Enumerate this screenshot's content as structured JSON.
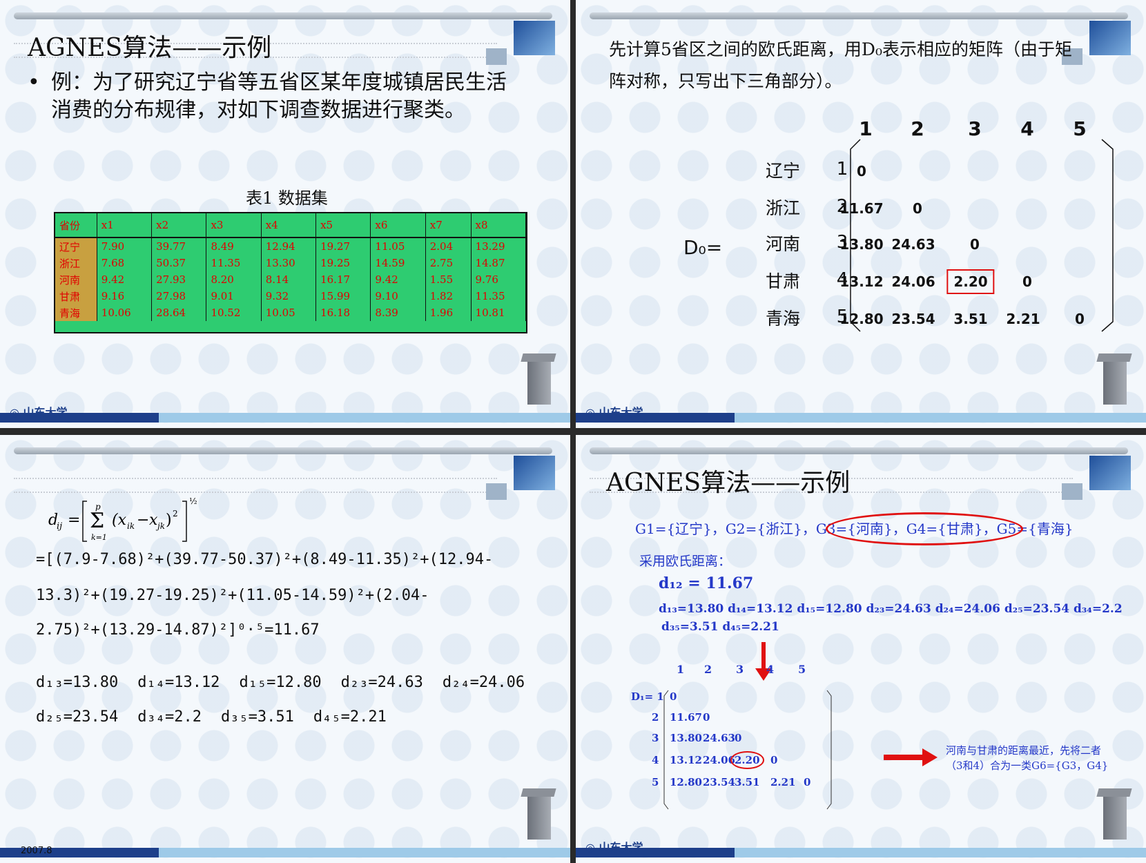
{
  "s1": {
    "title": "AGNES算法——示例",
    "bullet": "例：为了研究辽宁省等五省区某年度城镇居民生活消费的分布规律，对如下调查数据进行聚类。",
    "caption": "表1 数据集",
    "headers": [
      "省份",
      "x1",
      "x2",
      "x3",
      "x4",
      "x5",
      "x6",
      "x7",
      "x8"
    ],
    "rows": [
      [
        "辽宁",
        "7.90",
        "39.77",
        "8.49",
        "12.94",
        "19.27",
        "11.05",
        "2.04",
        "13.29"
      ],
      [
        "浙江",
        "7.68",
        "50.37",
        "11.35",
        "13.30",
        "19.25",
        "14.59",
        "2.75",
        "14.87"
      ],
      [
        "河南",
        "9.42",
        "27.93",
        "8.20",
        "8.14",
        "16.17",
        "9.42",
        "1.55",
        "9.76"
      ],
      [
        "甘肃",
        "9.16",
        "27.98",
        "9.01",
        "9.32",
        "15.99",
        "9.10",
        "1.82",
        "11.35"
      ],
      [
        "青海",
        "10.06",
        "28.64",
        "10.52",
        "10.05",
        "16.18",
        "8.39",
        "1.96",
        "10.81"
      ]
    ]
  },
  "s2": {
    "line1": "先计算5省区之间的欧氏距离，用D₀表示相应的矩阵（由于矩",
    "line2": "阵对称，只写出下三角部分）。",
    "label": "D₀=",
    "cols": [
      "1",
      "2",
      "3",
      "4",
      "5"
    ],
    "names": [
      "辽宁",
      "浙江",
      "河南",
      "甘肃",
      "青海"
    ],
    "idx": [
      "1",
      "2",
      "3",
      "4",
      "5"
    ],
    "cells": [
      [
        "0"
      ],
      [
        "11.67",
        "0"
      ],
      [
        "13.80",
        "24.63",
        "0"
      ],
      [
        "13.12",
        "24.06",
        "2.20",
        "0"
      ],
      [
        "12.80",
        "23.54",
        "3.51",
        "2.21",
        "0"
      ]
    ]
  },
  "s3": {
    "formula": "d_ij = [ Σ_{k=1}^{p} (x_ik − x_jk)² ]^½",
    "calc1": "=[(7.9-7.68)²+(39.77-50.37)²+(8.49-11.35)²+(12.94-",
    "calc2": "13.3)²+(19.27-19.25)²+(11.05-14.59)²+(2.04-",
    "calc3": "2.75)²+(13.29-14.87)²]⁰·⁵=11.67",
    "d_row1": [
      "d₁₃=13.80",
      "d₁₄=13.12",
      "d₁₅=12.80",
      "d₂₃=24.63",
      "d₂₄=24.06"
    ],
    "d_row2": [
      "d₂₅=23.54",
      "d₃₄=2.2",
      "d₃₅=3.51",
      "d₄₅=2.21"
    ],
    "footer": "2007.8"
  },
  "s4": {
    "title": "AGNES算法——示例",
    "groups": "G1={辽宁}，G2={浙江}，G3={河南}，G4={甘肃}，G5={青海}",
    "method": "采用欧氏距离：",
    "d12": "d₁₂ = 11.67",
    "dline1": "d₁₃=13.80  d₁₄=13.12  d₁₅=12.80  d₂₃=24.63  d₂₄=24.06  d₂₅=23.54  d₃₄=2.2",
    "dline2": "d₃₅=3.51  d₄₅=2.21",
    "cols": [
      "1",
      "2",
      "3",
      "4",
      "5"
    ],
    "label": "D₁= 1",
    "idx": [
      "2",
      "3",
      "4",
      "5"
    ],
    "cells": [
      [
        "0"
      ],
      [
        "11.67",
        "0"
      ],
      [
        "13.80",
        "24.63",
        "0"
      ],
      [
        "13.12",
        "24.06",
        "2.20",
        "0"
      ],
      [
        "12.80",
        "23.54",
        "3.51",
        "2.21",
        "0"
      ]
    ],
    "note1": "河南与甘肃的距离最近，先将二者",
    "note2": "（3和4）合为一类G6={G3，G4}"
  }
}
